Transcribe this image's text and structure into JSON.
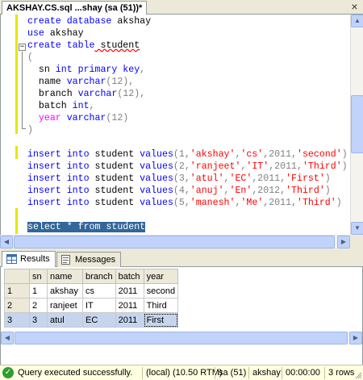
{
  "doc_tab": {
    "title": "AKSHAY.CS.sql ...shay (sa (51))*"
  },
  "close_glyph": "×",
  "editor": {
    "lines": [
      [
        {
          "t": "create database",
          "c": "kw"
        },
        {
          "t": " akshay",
          "c": ""
        }
      ],
      [
        {
          "t": "use",
          "c": "kw"
        },
        {
          "t": " akshay",
          "c": ""
        }
      ],
      [
        {
          "t": "create table",
          "c": "kw"
        },
        {
          "t": " student",
          "c": "und"
        }
      ],
      [
        {
          "t": "(",
          "c": "gy"
        }
      ],
      [
        {
          "t": "  sn ",
          "c": ""
        },
        {
          "t": "int primary key",
          "c": "kw"
        },
        {
          "t": ",",
          "c": "gy"
        }
      ],
      [
        {
          "t": "  name ",
          "c": ""
        },
        {
          "t": "varchar",
          "c": "kw"
        },
        {
          "t": "(12),",
          "c": "gy"
        }
      ],
      [
        {
          "t": "  branch ",
          "c": ""
        },
        {
          "t": "varchar",
          "c": "kw"
        },
        {
          "t": "(12),",
          "c": "gy"
        }
      ],
      [
        {
          "t": "  batch ",
          "c": ""
        },
        {
          "t": "int",
          "c": "kw"
        },
        {
          "t": ",",
          "c": "gy"
        }
      ],
      [
        {
          "t": "  year ",
          "c": "fn"
        },
        {
          "t": "varchar",
          "c": "kw"
        },
        {
          "t": "(12)",
          "c": "gy"
        }
      ],
      [
        {
          "t": ")",
          "c": "gy"
        }
      ],
      [],
      [
        {
          "t": "insert into",
          "c": "kw"
        },
        {
          "t": " student ",
          "c": ""
        },
        {
          "t": "values",
          "c": "kw"
        },
        {
          "t": "(1,",
          "c": "gy"
        },
        {
          "t": "'akshay'",
          "c": "str"
        },
        {
          "t": ",",
          "c": "gy"
        },
        {
          "t": "'cs'",
          "c": "str"
        },
        {
          "t": ",2011,",
          "c": "gy"
        },
        {
          "t": "'second'",
          "c": "str"
        },
        {
          "t": ")",
          "c": "gy"
        }
      ],
      [
        {
          "t": "insert into",
          "c": "kw"
        },
        {
          "t": " student ",
          "c": ""
        },
        {
          "t": "values",
          "c": "kw"
        },
        {
          "t": "(2,",
          "c": "gy"
        },
        {
          "t": "'ranjeet'",
          "c": "str"
        },
        {
          "t": ",",
          "c": "gy"
        },
        {
          "t": "'IT'",
          "c": "str"
        },
        {
          "t": ",2011,",
          "c": "gy"
        },
        {
          "t": "'Third'",
          "c": "str"
        },
        {
          "t": ")",
          "c": "gy"
        }
      ],
      [
        {
          "t": "insert into",
          "c": "kw"
        },
        {
          "t": " student ",
          "c": ""
        },
        {
          "t": "values",
          "c": "kw"
        },
        {
          "t": "(3,",
          "c": "gy"
        },
        {
          "t": "'atul'",
          "c": "str"
        },
        {
          "t": ",",
          "c": "gy"
        },
        {
          "t": "'EC'",
          "c": "str"
        },
        {
          "t": ",2011,",
          "c": "gy"
        },
        {
          "t": "'First'",
          "c": "str"
        },
        {
          "t": ")",
          "c": "gy"
        }
      ],
      [
        {
          "t": "insert into",
          "c": "kw"
        },
        {
          "t": " student ",
          "c": ""
        },
        {
          "t": "values",
          "c": "kw"
        },
        {
          "t": "(4,",
          "c": "gy"
        },
        {
          "t": "'anuj'",
          "c": "str"
        },
        {
          "t": ",",
          "c": "gy"
        },
        {
          "t": "'En'",
          "c": "str"
        },
        {
          "t": ",2012,",
          "c": "gy"
        },
        {
          "t": "'Third'",
          "c": "str"
        },
        {
          "t": ")",
          "c": "gy"
        }
      ],
      [
        {
          "t": "insert into",
          "c": "kw"
        },
        {
          "t": " student ",
          "c": ""
        },
        {
          "t": "values",
          "c": "kw"
        },
        {
          "t": "(5,",
          "c": "gy"
        },
        {
          "t": "'manesh'",
          "c": "str"
        },
        {
          "t": ",",
          "c": "gy"
        },
        {
          "t": "'Me'",
          "c": "str"
        },
        {
          "t": ",2011,",
          "c": "gy"
        },
        {
          "t": "'Third'",
          "c": "str"
        },
        {
          "t": ")",
          "c": "gy"
        }
      ],
      [],
      [
        {
          "t": "select * from student",
          "c": "sel"
        }
      ]
    ]
  },
  "results": {
    "tabs": [
      {
        "label": "Results",
        "icon": "grid-icon",
        "active": true
      },
      {
        "label": "Messages",
        "icon": "messages-icon",
        "active": false
      }
    ],
    "columns": [
      "sn",
      "name",
      "branch",
      "batch",
      "year"
    ],
    "rows": [
      {
        "num": "1",
        "cells": [
          "1",
          "akshay",
          "cs",
          "2011",
          "second"
        ]
      },
      {
        "num": "2",
        "cells": [
          "2",
          "ranjeet",
          "IT",
          "2011",
          "Third"
        ]
      },
      {
        "num": "3",
        "cells": [
          "3",
          "atul",
          "EC",
          "2011",
          "First"
        ]
      }
    ]
  },
  "status": {
    "message": "Query executed successfully.",
    "server": "(local) (10.50 RTM)",
    "user": "sa (51)",
    "database": "akshay",
    "time": "00:00:00",
    "rows": "3 rows"
  },
  "colors": {
    "keyword": "#0000ff",
    "string": "#ff0000",
    "function": "#ff00ff",
    "selection": "#336699",
    "status_bg": "#ffffe1"
  }
}
